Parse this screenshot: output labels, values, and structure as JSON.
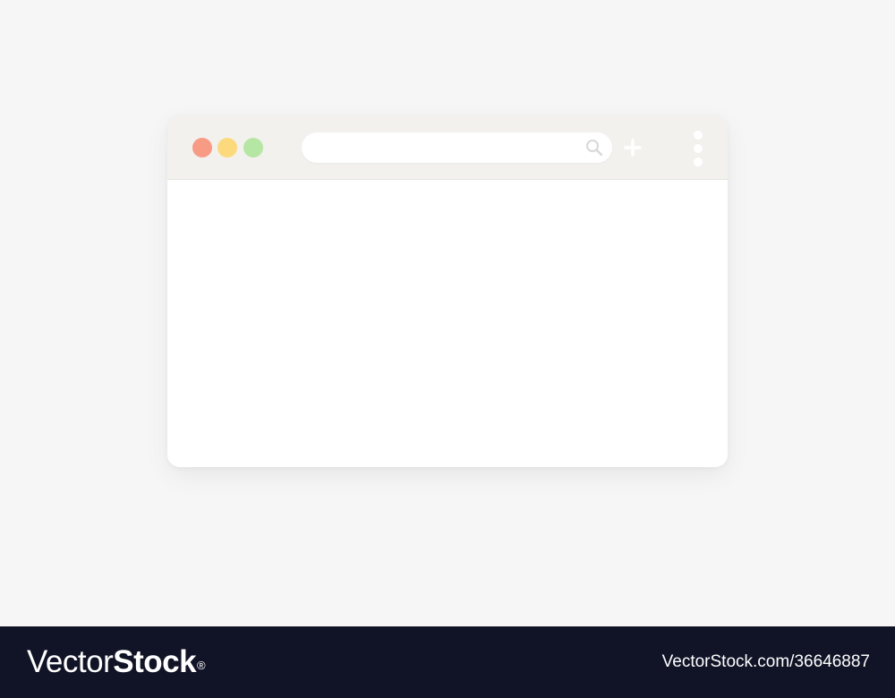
{
  "window": {
    "traffic_lights": {
      "close_color": "#f79b85",
      "minimize_color": "#fbd97c",
      "maximize_color": "#b5e6a3"
    },
    "address_bar": {
      "value": "",
      "placeholder": ""
    },
    "icons": {
      "search": "search-icon",
      "new_tab": "plus-icon",
      "menu": "vertical-ellipsis-icon"
    },
    "toolbar_color": "#f2f1ee",
    "content_color": "#ffffff"
  },
  "footer": {
    "logo_part1": "Vector",
    "logo_part2": "Stock",
    "logo_mark": "®",
    "url": "VectorStock.com/36646887",
    "background_color": "#111327"
  }
}
